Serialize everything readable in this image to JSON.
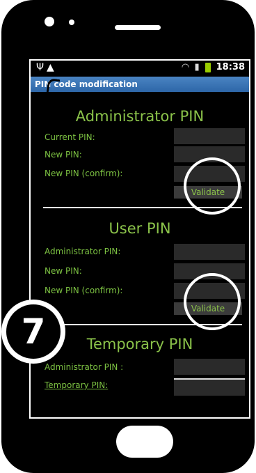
{
  "status": {
    "time": "18:38",
    "left_icons": [
      "usb-icon",
      "warning-icon"
    ],
    "right_icons": [
      "wifi-icon",
      "signal-icon",
      "battery-icon"
    ]
  },
  "app": {
    "title": "PIN code modification"
  },
  "admin_section": {
    "title": "Administrator PIN",
    "fields": [
      {
        "label": "Current PIN:",
        "value": ""
      },
      {
        "label": "New PIN:",
        "value": ""
      },
      {
        "label": "New PIN (confirm):",
        "value": ""
      }
    ],
    "validate_label": "Validate"
  },
  "user_section": {
    "title": "User PIN",
    "fields": [
      {
        "label": "Administrator PIN:",
        "value": ""
      },
      {
        "label": "New PIN:",
        "value": ""
      },
      {
        "label": "New PIN (confirm):",
        "value": ""
      }
    ],
    "validate_label": "Validate"
  },
  "temporary_section": {
    "title": "Temporary PIN",
    "fields": [
      {
        "label": "Administrator PIN :",
        "value": ""
      },
      {
        "label": "Temporary PIN:",
        "value": ""
      }
    ]
  },
  "step_badge": {
    "number": "7"
  },
  "colors": {
    "label_green": "#7cc142",
    "title_green": "#8bc34a",
    "titlebar_blue": "#2d66a8",
    "input_bg": "#2a2a2a"
  }
}
